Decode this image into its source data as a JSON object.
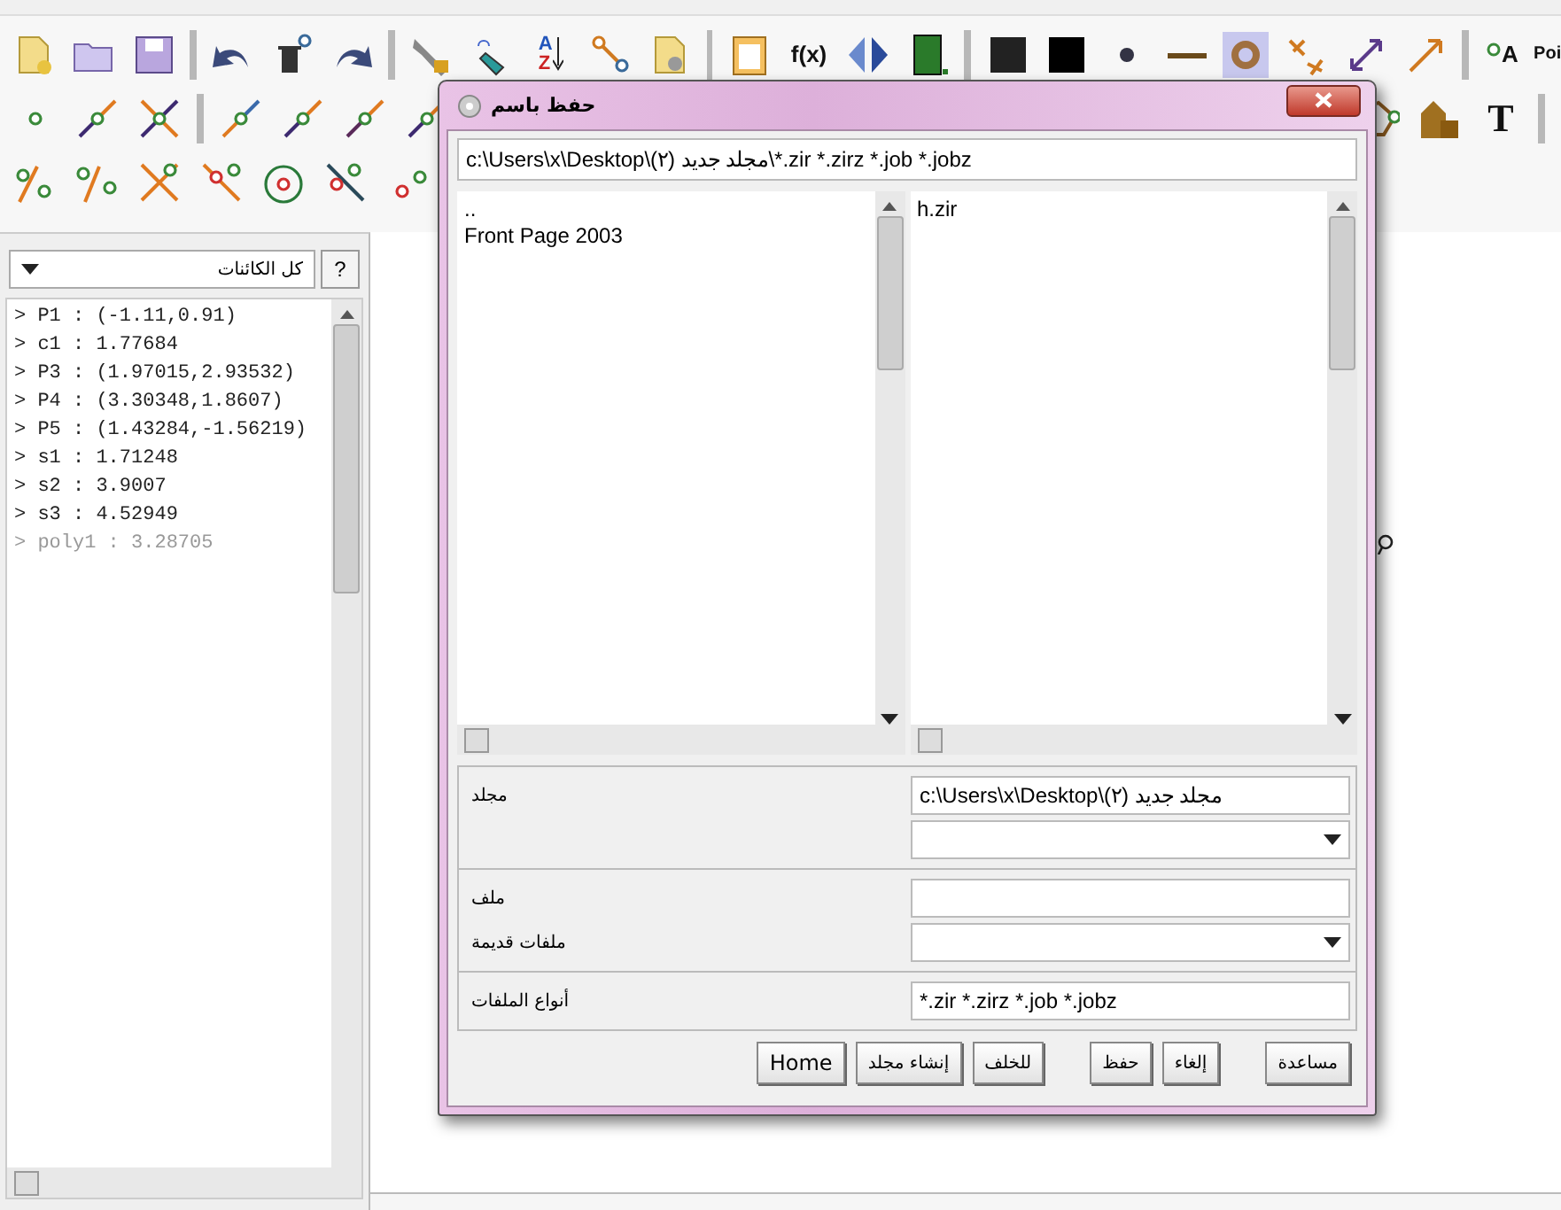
{
  "toolbar": {
    "function_label": "f(x)",
    "sort_letters": [
      "A",
      "Z"
    ],
    "label_tool_letter": "A",
    "text_tool_letter": "T",
    "cut_label": "Poi"
  },
  "objects_panel": {
    "filter": "كل الكائنات",
    "help": "?",
    "items": [
      {
        "text": "> P1 : (-1.11,0.91)",
        "hidden": false
      },
      {
        "text": "> c1 : 1.77684",
        "hidden": false
      },
      {
        "text": "> P3 : (1.97015,2.93532)",
        "hidden": false
      },
      {
        "text": "> P4 : (3.30348,1.8607)",
        "hidden": false
      },
      {
        "text": "> P5 : (1.43284,-1.56219)",
        "hidden": false
      },
      {
        "text": "> s1 : 1.71248",
        "hidden": false
      },
      {
        "text": "> s2 : 3.9007",
        "hidden": false
      },
      {
        "text": "> s3 : 4.52949",
        "hidden": false
      },
      {
        "text": "> poly1 : 3.28705",
        "hidden": true
      }
    ]
  },
  "dialog": {
    "title": "حفظ باسم",
    "path": "c:\\Users\\x\\Desktop\\مجلد جديد (٢)\\*.zir *.zirz *.job *.jobz",
    "folders": [
      "..",
      "Front Page 2003"
    ],
    "files": [
      "h.zir"
    ],
    "folder_label": "مجلد",
    "folder_value": "c:\\Users\\x\\Desktop\\مجلد جديد (٢)",
    "file_label": "ملف",
    "old_files_label": "ملفات قديمة",
    "types_label": "أنواع الملفات",
    "types_value": "*.zir *.zirz *.job *.jobz",
    "button_groups": [
      [
        "مساعدة"
      ],
      [
        "إلغاء",
        "حفظ"
      ],
      [
        "للخلف",
        "إنشاء مجلد",
        "Home"
      ]
    ]
  }
}
